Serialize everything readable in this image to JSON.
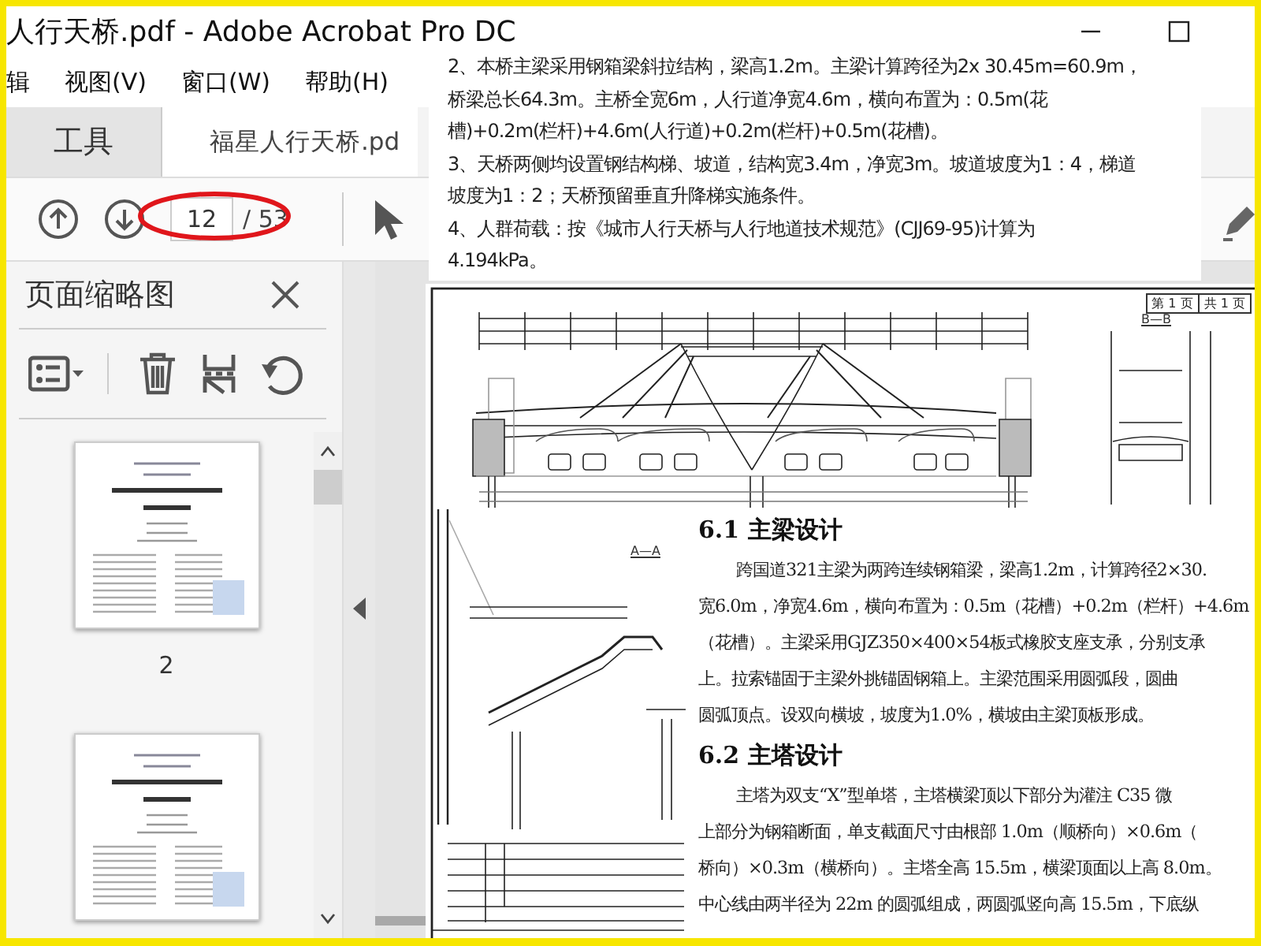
{
  "window": {
    "title": "人行天桥.pdf - Adobe Acrobat Pro DC"
  },
  "menu": [
    "辑",
    "视图(V)",
    "窗口(W)",
    "帮助(H)"
  ],
  "tabs": [
    {
      "label": "工具",
      "selected": false
    },
    {
      "label": "福星人行天桥.pd",
      "selected": true
    }
  ],
  "toolbar": {
    "page_field": {
      "value": "12"
    },
    "page_total": "/ 53"
  },
  "sidebar": {
    "title": "页面缩略图",
    "thumbnails": [
      {
        "kind": "page",
        "label": "2"
      },
      {
        "kind": "page"
      }
    ]
  },
  "notes_clip": {
    "lines": [
      "2、本桥主梁采用钢箱梁斜拉结构，梁高1.2m。主梁计算跨径为2x 30.45m=60.9m，",
      "桥梁总长64.3m。主桥全宽6m，人行道净宽4.6m，横向布置为：0.5m(花",
      "槽)+0.2m(栏杆)+4.6m(人行道)+0.2m(栏杆)+0.5m(花槽)。",
      "3、天桥两侧均设置钢结构梯、坡道，结构宽3.4m，净宽3m。坡道坡度为1：4，梯道",
      "坡度为1：2；天桥预留垂直升降梯实施条件。",
      "4、人群荷载：按《城市人行天桥与人行地道技术规范》(CJJ69-95)计算为",
      "4.194kPa。"
    ]
  },
  "drawing_clip": {
    "sheet_labels": [
      "第 1 页",
      "共 1 页"
    ],
    "section_labels": [
      "B—B",
      "A—A"
    ]
  },
  "text_clip": {
    "blocks": [
      {
        "kind": "heading",
        "text": "6.1 主梁设计"
      },
      {
        "kind": "first",
        "text": "跨国道321主梁为两跨连续钢箱梁，梁高1.2m，计算跨径2×30."
      },
      {
        "kind": "line",
        "text": "宽6.0m，净宽4.6m，横向布置为：0.5m（花槽）+0.2m（栏杆）+4.6m"
      },
      {
        "kind": "line",
        "text": "（花槽）。主梁采用GJZ350×400×54板式橡胶支座支承，分别支承"
      },
      {
        "kind": "line",
        "text": "上。拉索锚固于主梁外挑锚固钢箱上。主梁范围采用圆弧段，圆曲"
      },
      {
        "kind": "line",
        "text": "圆弧顶点。设双向横坡，坡度为1.0%，横坡由主梁顶板形成。"
      },
      {
        "kind": "heading",
        "text": "6.2 主塔设计"
      },
      {
        "kind": "first",
        "text": "主塔为双支“X”型单塔，主塔横梁顶以下部分为灌注 C35 微"
      },
      {
        "kind": "line",
        "text": "上部分为钢箱断面，单支截面尺寸由根部 1.0m（顺桥向）×0.6m（"
      },
      {
        "kind": "line",
        "text": "桥向）×0.3m（横桥向）。主塔全高 15.5m，横梁顶面以上高 8.0m。"
      },
      {
        "kind": "line",
        "text": "中心线由两半径为 22m 的圆弧组成，两圆弧竖向高 15.5m，下底纵"
      }
    ]
  }
}
